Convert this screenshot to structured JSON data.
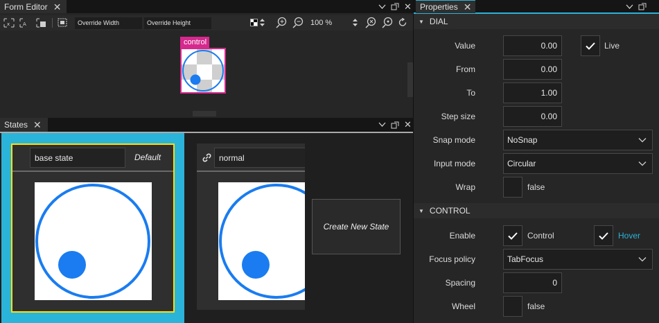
{
  "form_editor": {
    "tab_label": "Form Editor",
    "toolbar": {
      "override_width_placeholder": "Override Width",
      "override_height_placeholder": "Override Height",
      "zoom": "100 %"
    },
    "control_label": "control"
  },
  "states": {
    "tab_label": "States",
    "base_state": {
      "name": "base state",
      "badge": "Default"
    },
    "normal_state": {
      "name": "normal"
    },
    "create_label": "Create New State"
  },
  "properties": {
    "tab_label": "Properties",
    "dial_section": "DIAL",
    "control_section": "CONTROL",
    "value_label": "Value",
    "value": "0.00",
    "live_label": "Live",
    "from_label": "From",
    "from": "0.00",
    "to_label": "To",
    "to": "1.00",
    "step_label": "Step size",
    "step": "0.00",
    "snap_label": "Snap mode",
    "snap": "NoSnap",
    "input_label": "Input mode",
    "input": "Circular",
    "wrap_label": "Wrap",
    "wrap_value": "false",
    "enable_label": "Enable",
    "enable_text": "Control",
    "hover_text": "Hover",
    "focus_label": "Focus policy",
    "focus": "TabFocus",
    "spacing_label": "Spacing",
    "spacing": "0",
    "wheel_label": "Wheel",
    "wheel_value": "false"
  },
  "colors": {
    "accent": "#2bb4d9",
    "selection": "#d6298e",
    "state_highlight": "#ffe100",
    "dial_blue": "#1a7cf0",
    "hover_text": "#2bb4d9"
  }
}
